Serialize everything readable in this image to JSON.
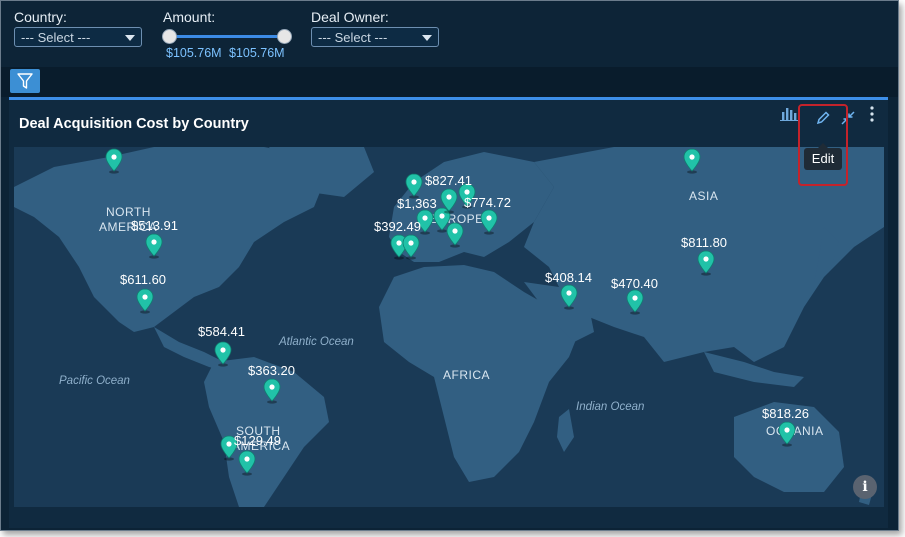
{
  "filters": {
    "country": {
      "label": "Country:",
      "value": "--- Select ---"
    },
    "amount": {
      "label": "Amount:",
      "min": "$105.76M",
      "max": "$105.76M"
    },
    "deal_owner": {
      "label": "Deal Owner:",
      "value": "--- Select ---"
    }
  },
  "panel": {
    "title": "Deal Acquisition Cost by Country",
    "tooltip": "Edit"
  },
  "map": {
    "oceans": [
      "Atlantic Ocean",
      "Pacific Ocean",
      "Indian Ocean"
    ],
    "continents": [
      "NORTH",
      "AMERICA",
      "SOUTH",
      "AMERICA",
      "AFRICA",
      "EUROPE",
      "ASIA",
      "OCEANIA"
    ],
    "values": [
      "$513.91",
      "$611.60",
      "$584.41",
      "$363.20",
      "$129.49",
      "$392.49",
      "$1,363",
      "$827.41",
      "$774.72",
      "$408.14",
      "$470.40",
      "$811.80",
      "$818.26"
    ]
  },
  "colors": {
    "accent": "#3d8ee8",
    "pin": "#21c2a8",
    "land": "#325f82",
    "ocean": "#1a3a56"
  },
  "icons": [
    "funnel-icon",
    "bar-chart-icon",
    "pencil-icon",
    "collapse-icon",
    "more-vertical-icon",
    "info-icon",
    "map-pin-icon"
  ]
}
